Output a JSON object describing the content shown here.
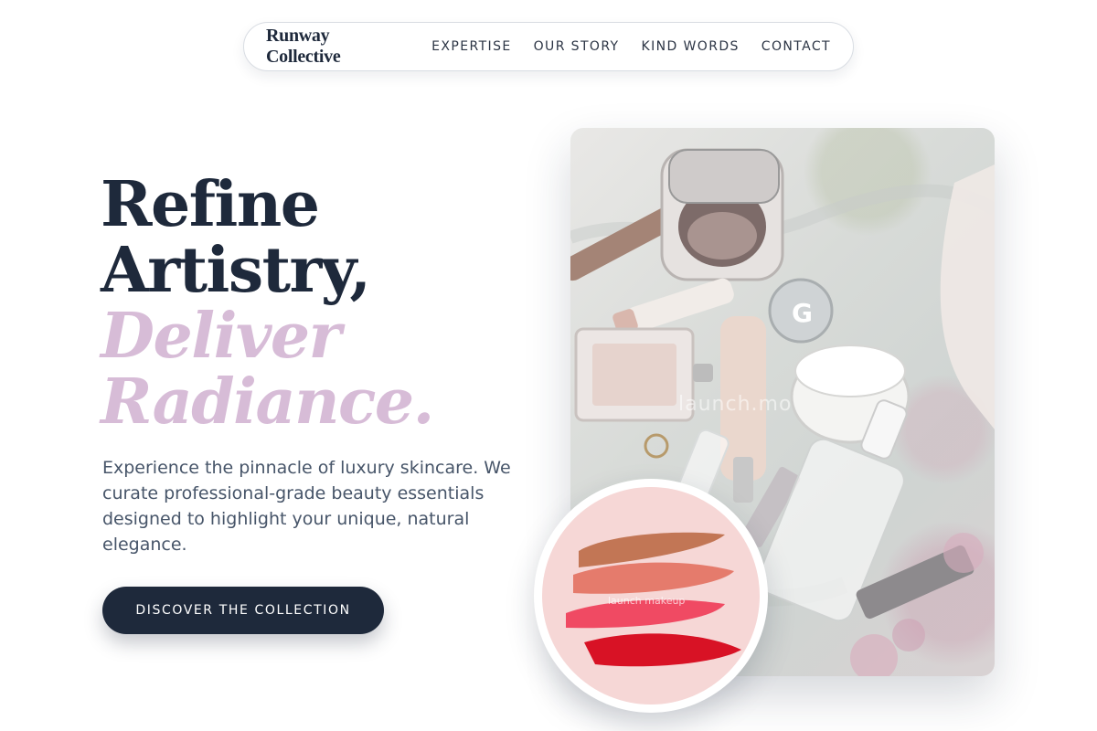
{
  "nav": {
    "brand": "Runway Collective",
    "links": [
      "EXPERTISE",
      "OUR STORY",
      "KIND WORDS",
      "CONTACT"
    ]
  },
  "hero": {
    "headline_line1": "Refine",
    "headline_line2": "Artistry,",
    "headline_accent1": "Deliver",
    "headline_accent2": "Radiance.",
    "description": "Experience the pinnacle of luxury skincare. We curate professional-grade beauty essentials designed to highlight your unique, natural elegance.",
    "cta_label": "DISCOVER THE COLLECTION",
    "photo_watermark": "launch.mo",
    "swatch_watermark": "launch makeup"
  },
  "colors": {
    "primary": "#1e293b",
    "accent": "#d7bcd7",
    "text_muted": "#475569"
  }
}
